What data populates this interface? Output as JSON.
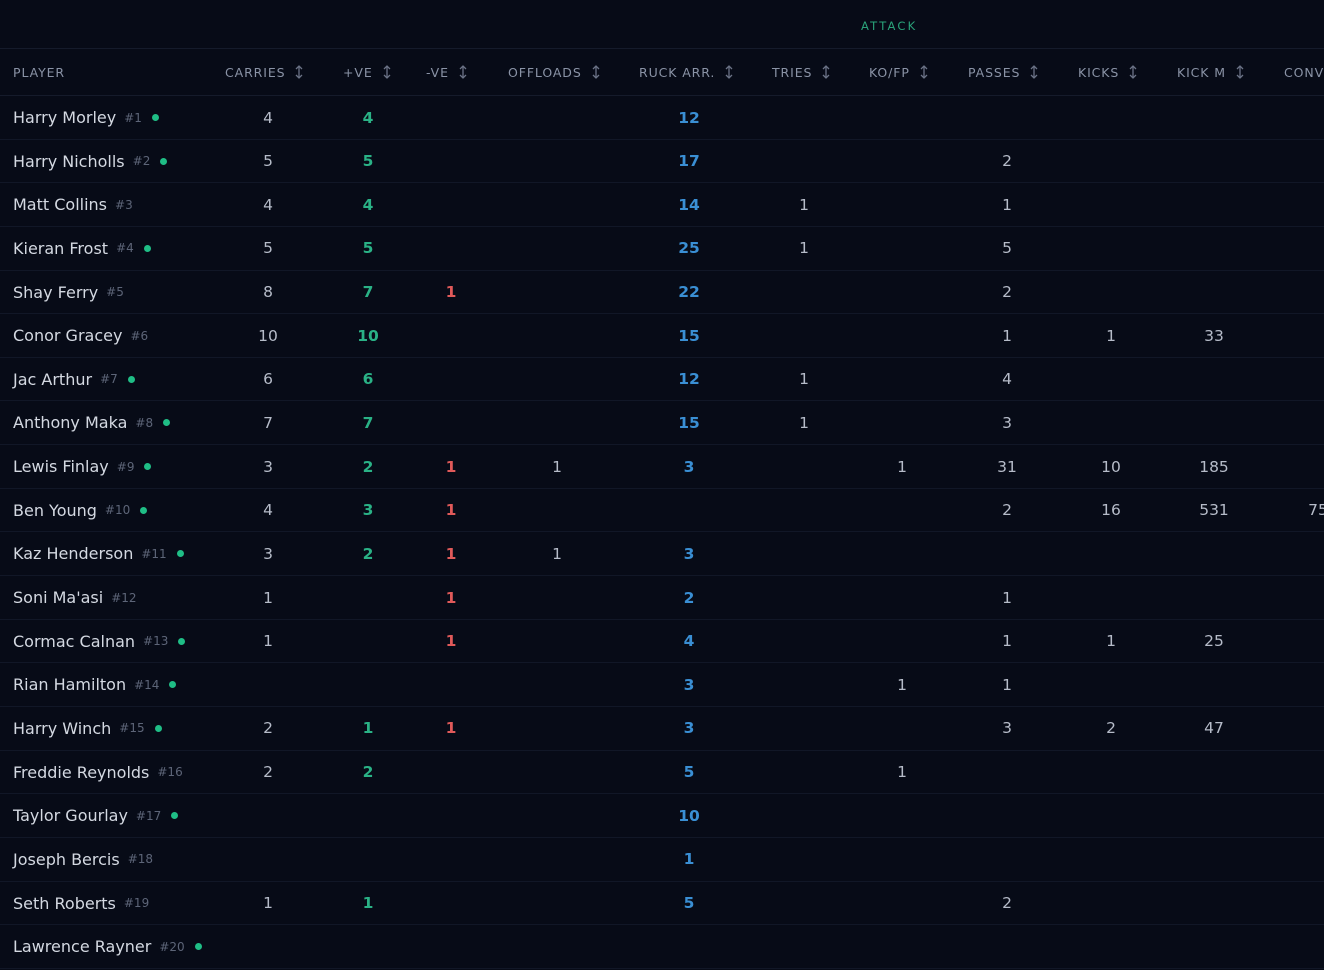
{
  "group_label": "ATTACK",
  "columns": [
    {
      "key": "player",
      "label": "PLAYER",
      "sortable": false
    },
    {
      "key": "carries",
      "label": "CARRIES",
      "sortable": true
    },
    {
      "key": "pos",
      "label": "+VE",
      "sortable": true
    },
    {
      "key": "neg",
      "label": "-VE",
      "sortable": true
    },
    {
      "key": "offloads",
      "label": "OFFLOADS",
      "sortable": true
    },
    {
      "key": "ruck",
      "label": "RUCK ARR.",
      "sortable": true
    },
    {
      "key": "tries",
      "label": "TRIES",
      "sortable": true
    },
    {
      "key": "kofp",
      "label": "KO/FP",
      "sortable": true
    },
    {
      "key": "passes",
      "label": "PASSES",
      "sortable": true
    },
    {
      "key": "kicks",
      "label": "KICKS",
      "sortable": true
    },
    {
      "key": "kickm",
      "label": "KICK M",
      "sortable": true
    },
    {
      "key": "conv",
      "label": "CONV",
      "sortable": false
    }
  ],
  "colors": {
    "positive": "#2ab286",
    "negative": "#e05a5a",
    "ruck": "#3a8fd4",
    "status_dot": "#1fbe86",
    "group_label": "#2aa37a"
  },
  "players": [
    {
      "name": "Harry Morley",
      "num": "#1",
      "active": true,
      "carries": "4",
      "pos": "4",
      "neg": "",
      "offloads": "",
      "ruck": "12",
      "tries": "",
      "kofp": "",
      "passes": "",
      "kicks": "",
      "kickm": "",
      "conv": ""
    },
    {
      "name": "Harry Nicholls",
      "num": "#2",
      "active": true,
      "carries": "5",
      "pos": "5",
      "neg": "",
      "offloads": "",
      "ruck": "17",
      "tries": "",
      "kofp": "",
      "passes": "2",
      "kicks": "",
      "kickm": "",
      "conv": ""
    },
    {
      "name": "Matt Collins",
      "num": "#3",
      "active": false,
      "carries": "4",
      "pos": "4",
      "neg": "",
      "offloads": "",
      "ruck": "14",
      "tries": "1",
      "kofp": "",
      "passes": "1",
      "kicks": "",
      "kickm": "",
      "conv": ""
    },
    {
      "name": "Kieran Frost",
      "num": "#4",
      "active": true,
      "carries": "5",
      "pos": "5",
      "neg": "",
      "offloads": "",
      "ruck": "25",
      "tries": "1",
      "kofp": "",
      "passes": "5",
      "kicks": "",
      "kickm": "",
      "conv": ""
    },
    {
      "name": "Shay Ferry",
      "num": "#5",
      "active": false,
      "carries": "8",
      "pos": "7",
      "neg": "1",
      "offloads": "",
      "ruck": "22",
      "tries": "",
      "kofp": "",
      "passes": "2",
      "kicks": "",
      "kickm": "",
      "conv": ""
    },
    {
      "name": "Conor Gracey",
      "num": "#6",
      "active": false,
      "carries": "10",
      "pos": "10",
      "neg": "",
      "offloads": "",
      "ruck": "15",
      "tries": "",
      "kofp": "",
      "passes": "1",
      "kicks": "1",
      "kickm": "33",
      "conv": ""
    },
    {
      "name": "Jac Arthur",
      "num": "#7",
      "active": true,
      "carries": "6",
      "pos": "6",
      "neg": "",
      "offloads": "",
      "ruck": "12",
      "tries": "1",
      "kofp": "",
      "passes": "4",
      "kicks": "",
      "kickm": "",
      "conv": ""
    },
    {
      "name": "Anthony Maka",
      "num": "#8",
      "active": true,
      "carries": "7",
      "pos": "7",
      "neg": "",
      "offloads": "",
      "ruck": "15",
      "tries": "1",
      "kofp": "",
      "passes": "3",
      "kicks": "",
      "kickm": "",
      "conv": ""
    },
    {
      "name": "Lewis Finlay",
      "num": "#9",
      "active": true,
      "carries": "3",
      "pos": "2",
      "neg": "1",
      "offloads": "1",
      "ruck": "3",
      "tries": "",
      "kofp": "1",
      "passes": "31",
      "kicks": "10",
      "kickm": "185",
      "conv": ""
    },
    {
      "name": "Ben Young",
      "num": "#10",
      "active": true,
      "carries": "4",
      "pos": "3",
      "neg": "1",
      "offloads": "",
      "ruck": "",
      "tries": "",
      "kofp": "",
      "passes": "2",
      "kicks": "16",
      "kickm": "531",
      "conv": "75"
    },
    {
      "name": "Kaz Henderson",
      "num": "#11",
      "active": true,
      "carries": "3",
      "pos": "2",
      "neg": "1",
      "offloads": "1",
      "ruck": "3",
      "tries": "",
      "kofp": "",
      "passes": "",
      "kicks": "",
      "kickm": "",
      "conv": ""
    },
    {
      "name": "Soni Ma'asi",
      "num": "#12",
      "active": false,
      "carries": "1",
      "pos": "",
      "neg": "1",
      "offloads": "",
      "ruck": "2",
      "tries": "",
      "kofp": "",
      "passes": "1",
      "kicks": "",
      "kickm": "",
      "conv": ""
    },
    {
      "name": "Cormac Calnan",
      "num": "#13",
      "active": true,
      "carries": "1",
      "pos": "",
      "neg": "1",
      "offloads": "",
      "ruck": "4",
      "tries": "",
      "kofp": "",
      "passes": "1",
      "kicks": "1",
      "kickm": "25",
      "conv": ""
    },
    {
      "name": "Rian Hamilton",
      "num": "#14",
      "active": true,
      "carries": "",
      "pos": "",
      "neg": "",
      "offloads": "",
      "ruck": "3",
      "tries": "",
      "kofp": "1",
      "passes": "1",
      "kicks": "",
      "kickm": "",
      "conv": ""
    },
    {
      "name": "Harry Winch",
      "num": "#15",
      "active": true,
      "carries": "2",
      "pos": "1",
      "neg": "1",
      "offloads": "",
      "ruck": "3",
      "tries": "",
      "kofp": "",
      "passes": "3",
      "kicks": "2",
      "kickm": "47",
      "conv": ""
    },
    {
      "name": "Freddie Reynolds",
      "num": "#16",
      "active": false,
      "carries": "2",
      "pos": "2",
      "neg": "",
      "offloads": "",
      "ruck": "5",
      "tries": "",
      "kofp": "1",
      "passes": "",
      "kicks": "",
      "kickm": "",
      "conv": ""
    },
    {
      "name": "Taylor Gourlay",
      "num": "#17",
      "active": true,
      "carries": "",
      "pos": "",
      "neg": "",
      "offloads": "",
      "ruck": "10",
      "tries": "",
      "kofp": "",
      "passes": "",
      "kicks": "",
      "kickm": "",
      "conv": ""
    },
    {
      "name": "Joseph Bercis",
      "num": "#18",
      "active": false,
      "carries": "",
      "pos": "",
      "neg": "",
      "offloads": "",
      "ruck": "1",
      "tries": "",
      "kofp": "",
      "passes": "",
      "kicks": "",
      "kickm": "",
      "conv": ""
    },
    {
      "name": "Seth Roberts",
      "num": "#19",
      "active": false,
      "carries": "1",
      "pos": "1",
      "neg": "",
      "offloads": "",
      "ruck": "5",
      "tries": "",
      "kofp": "",
      "passes": "2",
      "kicks": "",
      "kickm": "",
      "conv": ""
    },
    {
      "name": "Lawrence Rayner",
      "num": "#20",
      "active": true,
      "carries": "",
      "pos": "",
      "neg": "",
      "offloads": "",
      "ruck": "",
      "tries": "",
      "kofp": "",
      "passes": "",
      "kicks": "",
      "kickm": "",
      "conv": ""
    }
  ]
}
